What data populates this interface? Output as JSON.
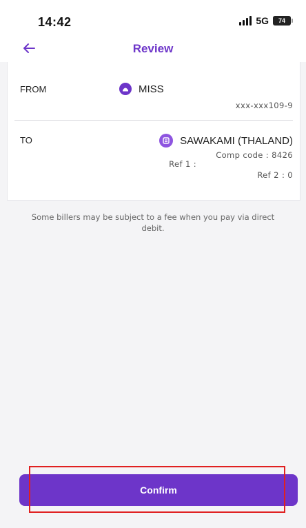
{
  "status_bar": {
    "time": "14:42",
    "network": "5G",
    "battery": "74"
  },
  "header": {
    "title": "Review",
    "back_icon": "arrow-left-icon"
  },
  "colors": {
    "accent": "#6d35c9",
    "highlight": "#e02020",
    "background": "#f4f4f6"
  },
  "from": {
    "label": "FROM",
    "name": "MISS",
    "account": "xxx-xxx109-9",
    "icon": "bank-icon"
  },
  "to": {
    "label": "TO",
    "name": "SAWAKAMI (THALAND)",
    "comp_code": "Comp code : 8426",
    "ref1": "Ref 1 :",
    "ref2": "Ref 2 : 0",
    "icon": "biller-icon"
  },
  "notice": "Some billers may be subject to a fee when you pay via direct debit.",
  "confirm_label": "Confirm"
}
